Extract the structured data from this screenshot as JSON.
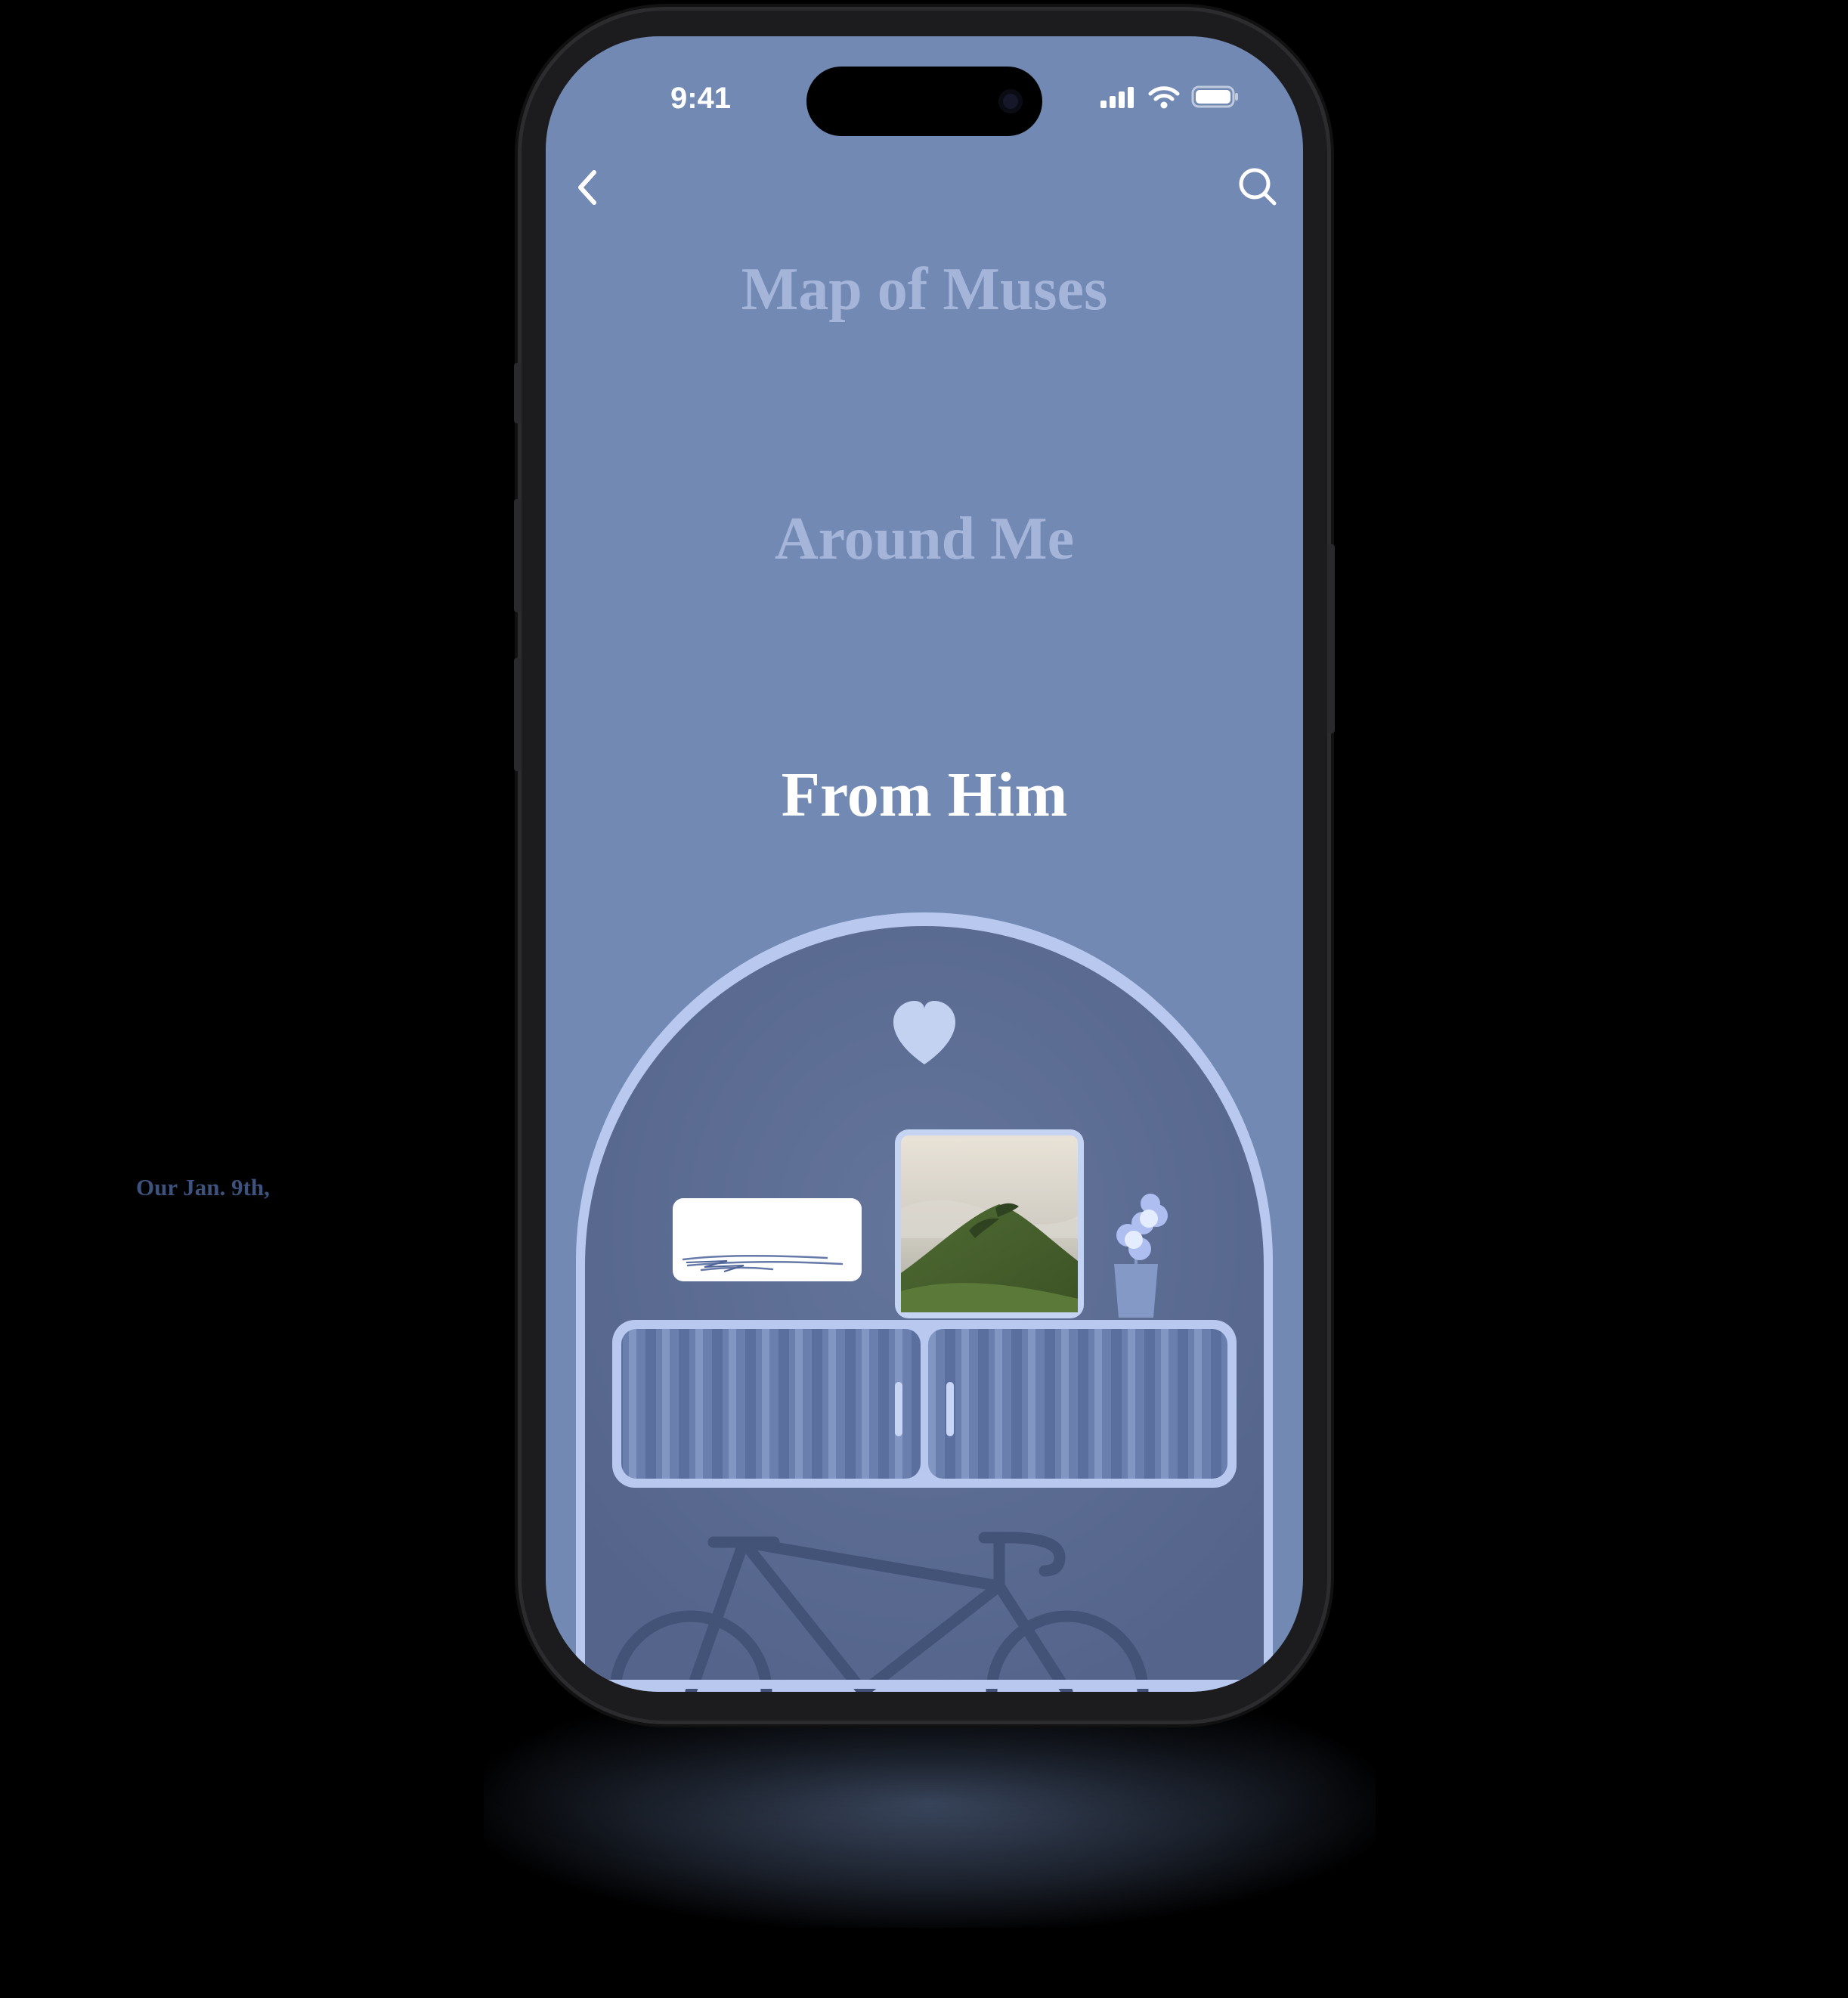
{
  "status_bar": {
    "time": "9:41"
  },
  "header": {
    "back_icon": "chevron-left-icon",
    "search_icon": "search-icon"
  },
  "menu": {
    "items": [
      {
        "label": "Map of Muses",
        "state": "inactive"
      },
      {
        "label": "Around Me",
        "state": "inactive"
      },
      {
        "label": "From Him",
        "state": "active"
      }
    ]
  },
  "card": {
    "heart_icon": "heart-icon",
    "note_text": "Our Jan. 9th,",
    "photo": "mountain-landscape-photo",
    "vase": "flower-vase",
    "cabinet": "sideboard-cabinet",
    "bicycle": "bicycle-illustration"
  },
  "colors": {
    "screen_bg": "#7189b3",
    "menu_inactive": "#a5b5da",
    "menu_active": "#ffffff",
    "arch_fill": "#5c6c8f",
    "arch_border": "#b8c8ee"
  }
}
